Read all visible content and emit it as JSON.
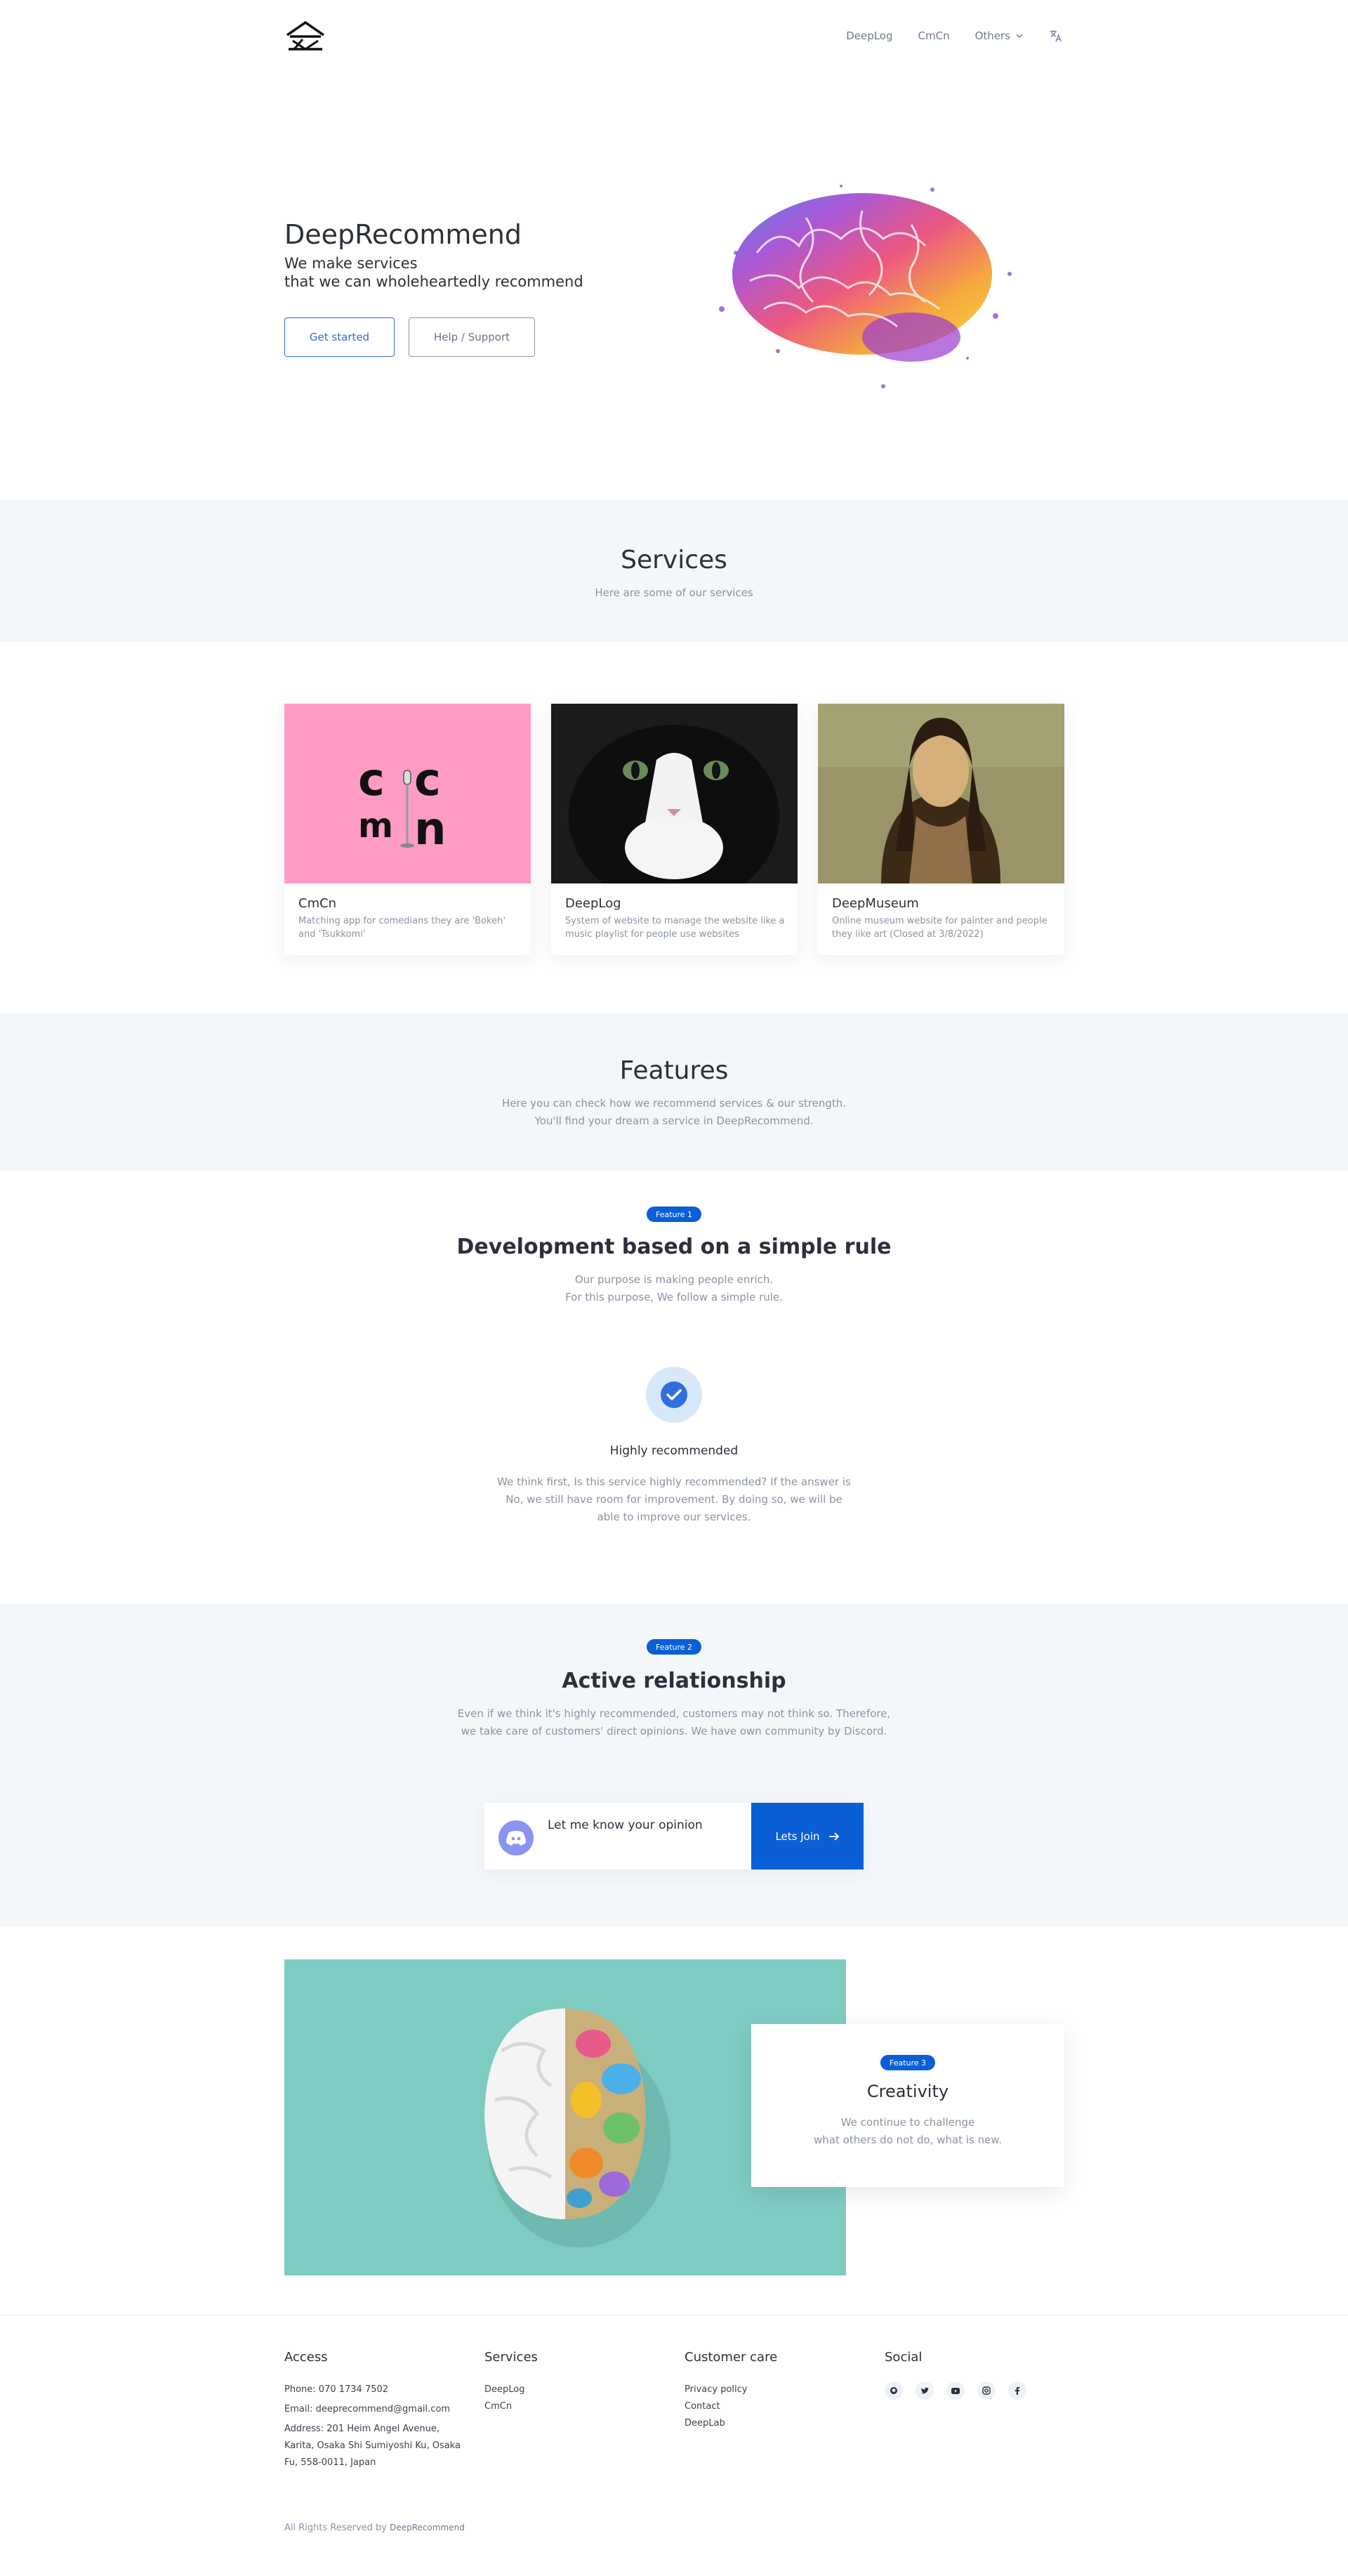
{
  "nav": {
    "items": [
      {
        "label": "DeepLog"
      },
      {
        "label": "CmCn"
      },
      {
        "label": "Others"
      }
    ],
    "translate_icon": "translate-icon"
  },
  "hero": {
    "title": "DeepRecommend",
    "subtitle_line1": "We make services",
    "subtitle_line2": "that we can wholeheartedly recommend",
    "primary_button": "Get started",
    "secondary_button": "Help / Support"
  },
  "services": {
    "title": "Services",
    "subtitle": "Here are some of our services",
    "cards": [
      {
        "title": "CmCn",
        "description": "Matching app for comedians they are 'Bokeh' and 'Tsukkomi'",
        "logo_top": "c",
        "logo_top2": "c",
        "logo_bottom": "m",
        "logo_bottom2": "n"
      },
      {
        "title": "DeepLog",
        "description": "System of website to manage the website like a music playlist for people use websites"
      },
      {
        "title": "DeepMuseum",
        "description": "Online museum website for painter and people they like art (Closed at 3/8/2022)"
      }
    ]
  },
  "features": {
    "title": "Features",
    "subtitle_line1": "Here you can check how we recommend services & our strength.",
    "subtitle_line2": "You'll find your dream a service in DeepRecommend."
  },
  "feature1": {
    "badge": "Feature 1",
    "title": "Development based on a simple rule",
    "text_line1": "Our purpose is making people enrich.",
    "text_line2": "For this purpose, We follow a simple rule.",
    "item_title": "Highly recommended",
    "item_text": "We think first, Is this service highly recommended? If the answer is No, we still have room for improvement. By doing so, we will be able to improve our services."
  },
  "feature2": {
    "badge": "Feature 2",
    "title": "Active relationship",
    "text": "Even if we think it's highly recommended, customers may not think so. Therefore, we take care of customers' direct opinions. We have own community by Discord.",
    "discord_text": "Let me know your opinion",
    "join_button": "Lets Join"
  },
  "feature3": {
    "badge": "Feature 3",
    "title": "Creativity",
    "text_line1": "We continue to challenge",
    "text_line2": "what others do not do, what is new."
  },
  "footer": {
    "access": {
      "title": "Access",
      "phone": "Phone: 070 1734 7502",
      "email": "Email: deeprecommend@gmail.com",
      "address": "Address: 201 Heim Angel Avenue, Karita, Osaka Shi Sumiyoshi Ku, Osaka Fu, 558-0011, Japan"
    },
    "services": {
      "title": "Services",
      "links": [
        "DeepLog",
        "CmCn"
      ]
    },
    "customer_care": {
      "title": "Customer care",
      "links": [
        "Privacy policy",
        "Contact",
        "DeepLab"
      ]
    },
    "social": {
      "title": "Social",
      "icons": [
        "github-icon",
        "twitter-icon",
        "youtube-icon",
        "instagram-icon",
        "facebook-icon"
      ]
    },
    "copyright": "All Rights Reserved by",
    "copyright_brand": "DeepRecommend"
  },
  "colors": {
    "accent": "#0a5fd6",
    "band": "#f4f7fa",
    "cmcn_pink": "#ff9cc6",
    "teal": "#7ecbc2"
  }
}
